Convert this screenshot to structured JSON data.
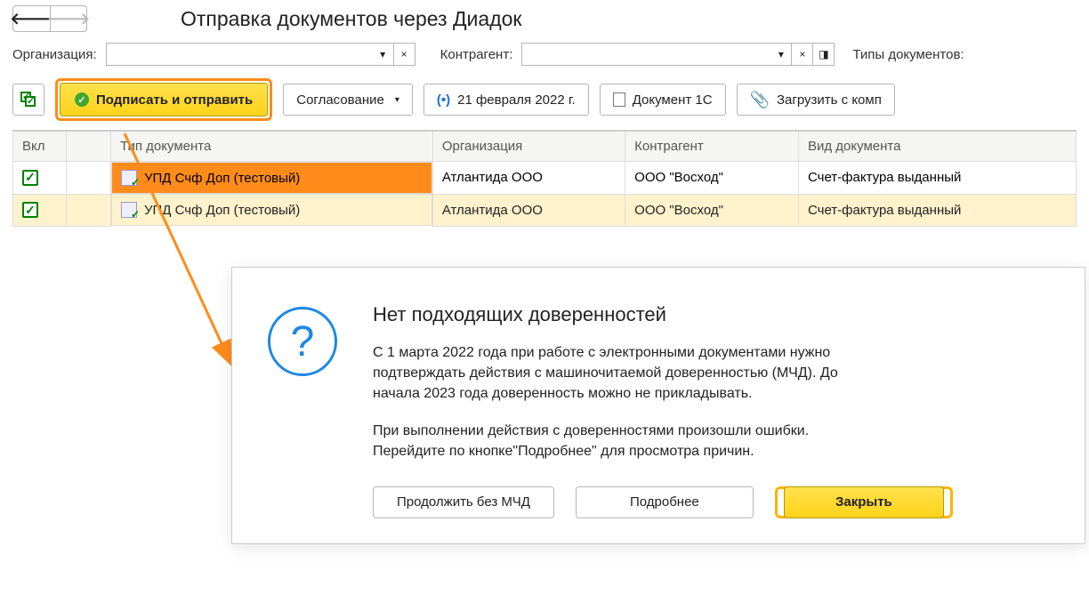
{
  "header": {
    "title": "Отправка документов через Диадок"
  },
  "filters": {
    "org_label": "Организация:",
    "org_value": "",
    "partner_label": "Контрагент:",
    "partner_value": "",
    "doctypes_label": "Типы документов:"
  },
  "toolbar": {
    "sign_send": "Подписать и отправить",
    "approval": "Согласование",
    "date": "21 февраля 2022 г.",
    "doc1c": "Документ 1С",
    "upload": "Загрузить с комп"
  },
  "table": {
    "columns": {
      "vkl": "Вкл",
      "doc_type": "Тип документа",
      "org": "Организация",
      "partner": "Контрагент",
      "doc_kind": "Вид документа"
    },
    "rows": [
      {
        "checked": true,
        "highlight": "orange",
        "doc_type": "УПД Счф Доп (тестовый)",
        "org": "Атлантида ООО",
        "partner": "ООО \"Восход\"",
        "doc_kind": "Счет-фактура выданный"
      },
      {
        "checked": true,
        "highlight": "yellow",
        "doc_type": "УПД Счф Доп (тестовый)",
        "org": "Атлантида ООО",
        "partner": "ООО \"Восход\"",
        "doc_kind": "Счет-фактура выданный"
      }
    ]
  },
  "dialog": {
    "title": "Нет подходящих доверенностей",
    "para1": "С 1 марта 2022 года при работе с электронными документами нужно подтверждать действия с машиночитаемой доверенностью (МЧД). До начала 2023 года доверенность можно не прикладывать.",
    "para2": "При выполнении действия с доверенностями произошли ошибки. Перейдите по кнопке\"Подробнее\" для просмотра причин.",
    "btn_continue": "Продолжить без МЧД",
    "btn_more": "Подробнее",
    "btn_close": "Закрыть"
  }
}
